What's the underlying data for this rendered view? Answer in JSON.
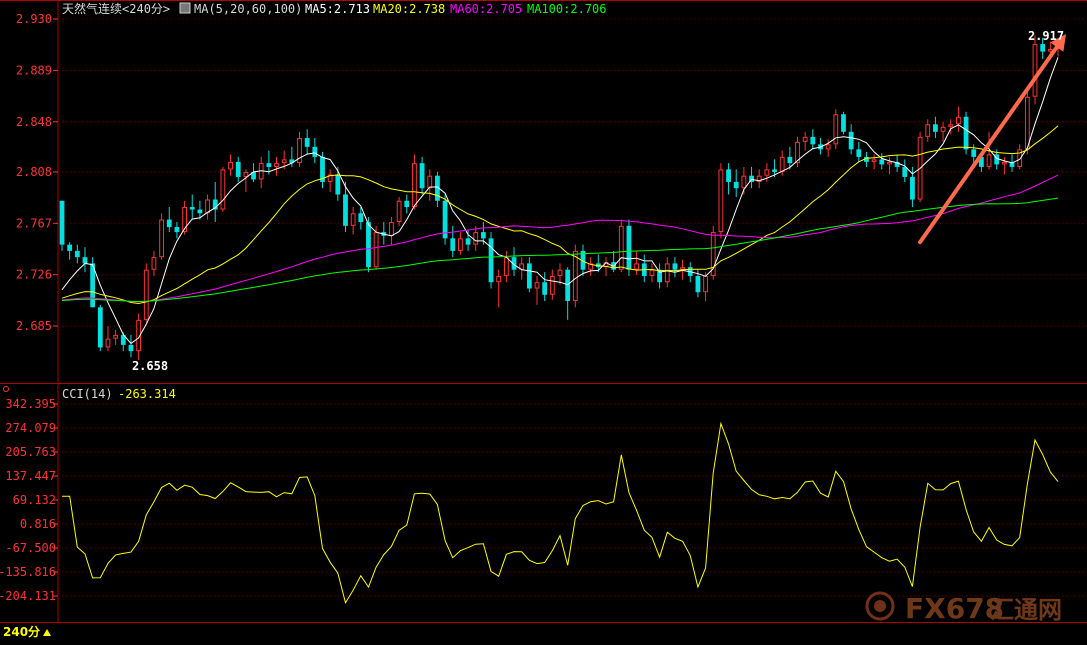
{
  "header": {
    "instrument": "天然气连续",
    "period": "<240分>",
    "ma_params": "MA(5,20,60,100)",
    "ma5": "MA5:2.713",
    "ma20": "MA20:2.738",
    "ma60": "MA60:2.705",
    "ma100": "MA100:2.706"
  },
  "indicator": {
    "label": "CCI(14)",
    "value": "-263.314"
  },
  "annotations": {
    "high": "2.917",
    "low": "2.658"
  },
  "footer": {
    "period_button": "240分"
  },
  "watermark": {
    "text": "FX678",
    "suffix": "汇通网"
  },
  "colors": {
    "up": "#ff3232",
    "down": "#00e0e0",
    "ma5": "#ffffff",
    "ma20": "#ffff00",
    "ma60": "#ff00ff",
    "ma100": "#00ff00",
    "cci": "#ffff00",
    "axis": "#ff3232",
    "arrow": "#ff6a4d"
  },
  "chart_data": [
    {
      "type": "candlestick",
      "title": "天然气连续 <240分>",
      "y_ticks": [
        "2.930",
        "2.889",
        "2.848",
        "2.808",
        "2.767",
        "2.726",
        "2.685"
      ],
      "ylim": [
        2.642,
        2.93
      ],
      "ohlc": [
        [
          2.785,
          2.785,
          2.745,
          2.75
        ],
        [
          2.75,
          2.752,
          2.738,
          2.745
        ],
        [
          2.745,
          2.75,
          2.735,
          2.74
        ],
        [
          2.74,
          2.748,
          2.728,
          2.735
        ],
        [
          2.735,
          2.74,
          2.7,
          2.7
        ],
        [
          2.7,
          2.702,
          2.665,
          2.668
        ],
        [
          2.668,
          2.685,
          2.665,
          2.675
        ],
        [
          2.675,
          2.682,
          2.67,
          2.678
        ],
        [
          2.678,
          2.68,
          2.665,
          2.67
        ],
        [
          2.67,
          2.678,
          2.66,
          2.665
        ],
        [
          2.665,
          2.695,
          2.658,
          2.69
        ],
        [
          2.69,
          2.735,
          2.688,
          2.73
        ],
        [
          2.73,
          2.745,
          2.725,
          2.74
        ],
        [
          2.74,
          2.775,
          2.738,
          2.77
        ],
        [
          2.77,
          2.78,
          2.76,
          2.764
        ],
        [
          2.764,
          2.768,
          2.755,
          2.76
        ],
        [
          2.76,
          2.785,
          2.758,
          2.78
        ],
        [
          2.78,
          2.79,
          2.77,
          2.778
        ],
        [
          2.778,
          2.785,
          2.77,
          2.775
        ],
        [
          2.775,
          2.79,
          2.77,
          2.786
        ],
        [
          2.786,
          2.8,
          2.768,
          2.778
        ],
        [
          2.778,
          2.812,
          2.776,
          2.81
        ],
        [
          2.81,
          2.822,
          2.805,
          2.816
        ],
        [
          2.816,
          2.82,
          2.8,
          2.804
        ],
        [
          2.804,
          2.81,
          2.792,
          2.808
        ],
        [
          2.808,
          2.815,
          2.8,
          2.802
        ],
        [
          2.802,
          2.82,
          2.795,
          2.815
        ],
        [
          2.815,
          2.825,
          2.806,
          2.812
        ],
        [
          2.812,
          2.82,
          2.805,
          2.815
        ],
        [
          2.815,
          2.825,
          2.81,
          2.818
        ],
        [
          2.818,
          2.828,
          2.812,
          2.815
        ],
        [
          2.815,
          2.84,
          2.812,
          2.835
        ],
        [
          2.835,
          2.842,
          2.822,
          2.828
        ],
        [
          2.828,
          2.835,
          2.815,
          2.82
        ],
        [
          2.82,
          2.824,
          2.795,
          2.8
        ],
        [
          2.8,
          2.81,
          2.792,
          2.806
        ],
        [
          2.806,
          2.812,
          2.785,
          2.79
        ],
        [
          2.79,
          2.8,
          2.76,
          2.765
        ],
        [
          2.765,
          2.78,
          2.758,
          2.775
        ],
        [
          2.775,
          2.78,
          2.762,
          2.768
        ],
        [
          2.768,
          2.772,
          2.728,
          2.732
        ],
        [
          2.732,
          2.765,
          2.73,
          2.76
        ],
        [
          2.76,
          2.768,
          2.75,
          2.757
        ],
        [
          2.757,
          2.772,
          2.75,
          2.768
        ],
        [
          2.768,
          2.788,
          2.765,
          2.785
        ],
        [
          2.785,
          2.79,
          2.775,
          2.78
        ],
        [
          2.78,
          2.822,
          2.778,
          2.815
        ],
        [
          2.815,
          2.82,
          2.79,
          2.795
        ],
        [
          2.795,
          2.81,
          2.785,
          2.805
        ],
        [
          2.805,
          2.808,
          2.78,
          2.785
        ],
        [
          2.785,
          2.79,
          2.75,
          2.755
        ],
        [
          2.755,
          2.765,
          2.74,
          2.745
        ],
        [
          2.745,
          2.76,
          2.742,
          2.755
        ],
        [
          2.755,
          2.762,
          2.745,
          2.75
        ],
        [
          2.75,
          2.765,
          2.745,
          2.76
        ],
        [
          2.76,
          2.768,
          2.75,
          2.755
        ],
        [
          2.755,
          2.76,
          2.715,
          2.72
        ],
        [
          2.72,
          2.73,
          2.7,
          2.725
        ],
        [
          2.725,
          2.745,
          2.72,
          2.74
        ],
        [
          2.74,
          2.748,
          2.725,
          2.73
        ],
        [
          2.73,
          2.74,
          2.722,
          2.735
        ],
        [
          2.735,
          2.74,
          2.712,
          2.715
        ],
        [
          2.715,
          2.725,
          2.702,
          2.72
        ],
        [
          2.72,
          2.728,
          2.705,
          2.71
        ],
        [
          2.71,
          2.73,
          2.706,
          2.725
        ],
        [
          2.725,
          2.735,
          2.718,
          2.73
        ],
        [
          2.73,
          2.732,
          2.69,
          2.705
        ],
        [
          2.705,
          2.75,
          2.7,
          2.745
        ],
        [
          2.745,
          2.75,
          2.725,
          2.73
        ],
        [
          2.73,
          2.74,
          2.725,
          2.735
        ],
        [
          2.735,
          2.742,
          2.728,
          2.732
        ],
        [
          2.732,
          2.74,
          2.725,
          2.736
        ],
        [
          2.736,
          2.745,
          2.728,
          2.73
        ],
        [
          2.73,
          2.77,
          2.728,
          2.765
        ],
        [
          2.765,
          2.77,
          2.725,
          2.73
        ],
        [
          2.73,
          2.745,
          2.726,
          2.735
        ],
        [
          2.735,
          2.742,
          2.72,
          2.725
        ],
        [
          2.725,
          2.735,
          2.72,
          2.73
        ],
        [
          2.73,
          2.735,
          2.715,
          2.72
        ],
        [
          2.72,
          2.74,
          2.716,
          2.735
        ],
        [
          2.735,
          2.74,
          2.724,
          2.73
        ],
        [
          2.73,
          2.738,
          2.722,
          2.732
        ],
        [
          2.732,
          2.736,
          2.72,
          2.725
        ],
        [
          2.725,
          2.73,
          2.708,
          2.712
        ],
        [
          2.712,
          2.728,
          2.705,
          2.725
        ],
        [
          2.725,
          2.765,
          2.722,
          2.76
        ],
        [
          2.76,
          2.815,
          2.755,
          2.81
        ],
        [
          2.81,
          2.815,
          2.79,
          2.8
        ],
        [
          2.8,
          2.81,
          2.788,
          2.795
        ],
        [
          2.795,
          2.812,
          2.79,
          2.805
        ],
        [
          2.805,
          2.812,
          2.795,
          2.8
        ],
        [
          2.8,
          2.81,
          2.795,
          2.805
        ],
        [
          2.805,
          2.815,
          2.8,
          2.81
        ],
        [
          2.81,
          2.818,
          2.804,
          2.808
        ],
        [
          2.808,
          2.825,
          2.805,
          2.82
        ],
        [
          2.82,
          2.828,
          2.81,
          2.815
        ],
        [
          2.815,
          2.836,
          2.812,
          2.832
        ],
        [
          2.832,
          2.84,
          2.825,
          2.836
        ],
        [
          2.836,
          2.842,
          2.826,
          2.83
        ],
        [
          2.83,
          2.835,
          2.822,
          2.826
        ],
        [
          2.826,
          2.834,
          2.82,
          2.83
        ],
        [
          2.83,
          2.858,
          2.826,
          2.854
        ],
        [
          2.854,
          2.856,
          2.838,
          2.84
        ],
        [
          2.84,
          2.846,
          2.822,
          2.826
        ],
        [
          2.826,
          2.832,
          2.816,
          2.82
        ],
        [
          2.82,
          2.824,
          2.812,
          2.816
        ],
        [
          2.816,
          2.822,
          2.81,
          2.818
        ],
        [
          2.818,
          2.823,
          2.81,
          2.814
        ],
        [
          2.814,
          2.82,
          2.806,
          2.816
        ],
        [
          2.816,
          2.822,
          2.808,
          2.812
        ],
        [
          2.812,
          2.818,
          2.8,
          2.804
        ],
        [
          2.804,
          2.812,
          2.78,
          2.786
        ],
        [
          2.786,
          2.84,
          2.784,
          2.836
        ],
        [
          2.836,
          2.85,
          2.832,
          2.846
        ],
        [
          2.846,
          2.852,
          2.835,
          2.84
        ],
        [
          2.84,
          2.848,
          2.832,
          2.844
        ],
        [
          2.844,
          2.85,
          2.838,
          2.846
        ],
        [
          2.846,
          2.86,
          2.84,
          2.852
        ],
        [
          2.852,
          2.856,
          2.822,
          2.826
        ],
        [
          2.826,
          2.83,
          2.812,
          2.82
        ],
        [
          2.82,
          2.824,
          2.808,
          2.812
        ],
        [
          2.812,
          2.84,
          2.81,
          2.822
        ],
        [
          2.822,
          2.826,
          2.81,
          2.814
        ],
        [
          2.814,
          2.82,
          2.806,
          2.816
        ],
        [
          2.816,
          2.822,
          2.808,
          2.812
        ],
        [
          2.812,
          2.83,
          2.81,
          2.826
        ],
        [
          2.826,
          2.872,
          2.822,
          2.868
        ],
        [
          2.868,
          2.917,
          2.862,
          2.91
        ],
        [
          2.91,
          2.915,
          2.898,
          2.904
        ],
        [
          2.904,
          2.912,
          2.898,
          2.906
        ],
        [
          2.906,
          2.915,
          2.9,
          2.909
        ]
      ],
      "indicators": {
        "MA5": "white",
        "MA20": "yellow",
        "MA60": "magenta",
        "MA100": "green"
      },
      "arrow": {
        "from": 112,
        "to": 130,
        "from_price": 2.752,
        "to_price": 2.918
      }
    },
    {
      "type": "line",
      "title": "CCI(14)",
      "y_ticks": [
        "342.395",
        "274.079",
        "205.763",
        "137.447",
        "69.132",
        "0.816",
        "-67.500",
        "-135.816",
        "-204.131"
      ],
      "ylim": [
        -272.447,
        342.395
      ]
    }
  ]
}
